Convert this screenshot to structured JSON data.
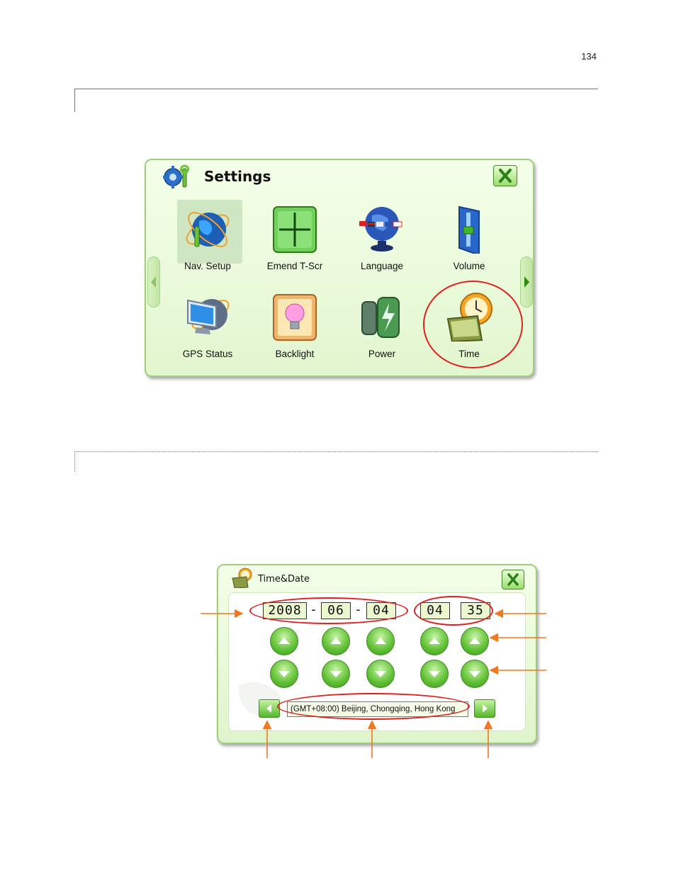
{
  "page_number": "134",
  "settings_window": {
    "title": "Settings",
    "items": [
      {
        "label": "Nav. Setup"
      },
      {
        "label": "Emend T-Scr"
      },
      {
        "label": "Language"
      },
      {
        "label": "Volume"
      },
      {
        "label": "GPS Status"
      },
      {
        "label": "Backlight"
      },
      {
        "label": "Power"
      },
      {
        "label": "Time"
      }
    ],
    "icons": [
      "settings-gear-wrench-icon",
      "close-x-icon",
      "globe-wrench-icon",
      "crosshair-screen-icon",
      "flags-globe-icon",
      "volume-slider-icon",
      "monitor-satellite-icon",
      "lightbulb-icon",
      "battery-icon",
      "clock-calendar-icon",
      "left-arrow-icon",
      "right-arrow-icon"
    ],
    "highlighted_item": "Time",
    "selected_item": "Nav. Setup"
  },
  "time_date_window": {
    "title": "Time&Date",
    "year": "2008",
    "month": "06",
    "day": "04",
    "hour": "04",
    "minute": "35",
    "date_separator": "-",
    "timezone": "(GMT+08:00) Beijing, Chongqing, Hong Kong",
    "icons": [
      "clock-calendar-icon",
      "close-x-icon",
      "up-arrow-icon",
      "down-arrow-icon",
      "left-arrow-icon",
      "right-arrow-icon"
    ]
  },
  "colors": {
    "window_green": "#9fcf7e",
    "button_green": "#56b72b",
    "annotation_red": "#e02020",
    "annotation_orange": "#f07820",
    "rule_blue": "#4a7fc1"
  }
}
